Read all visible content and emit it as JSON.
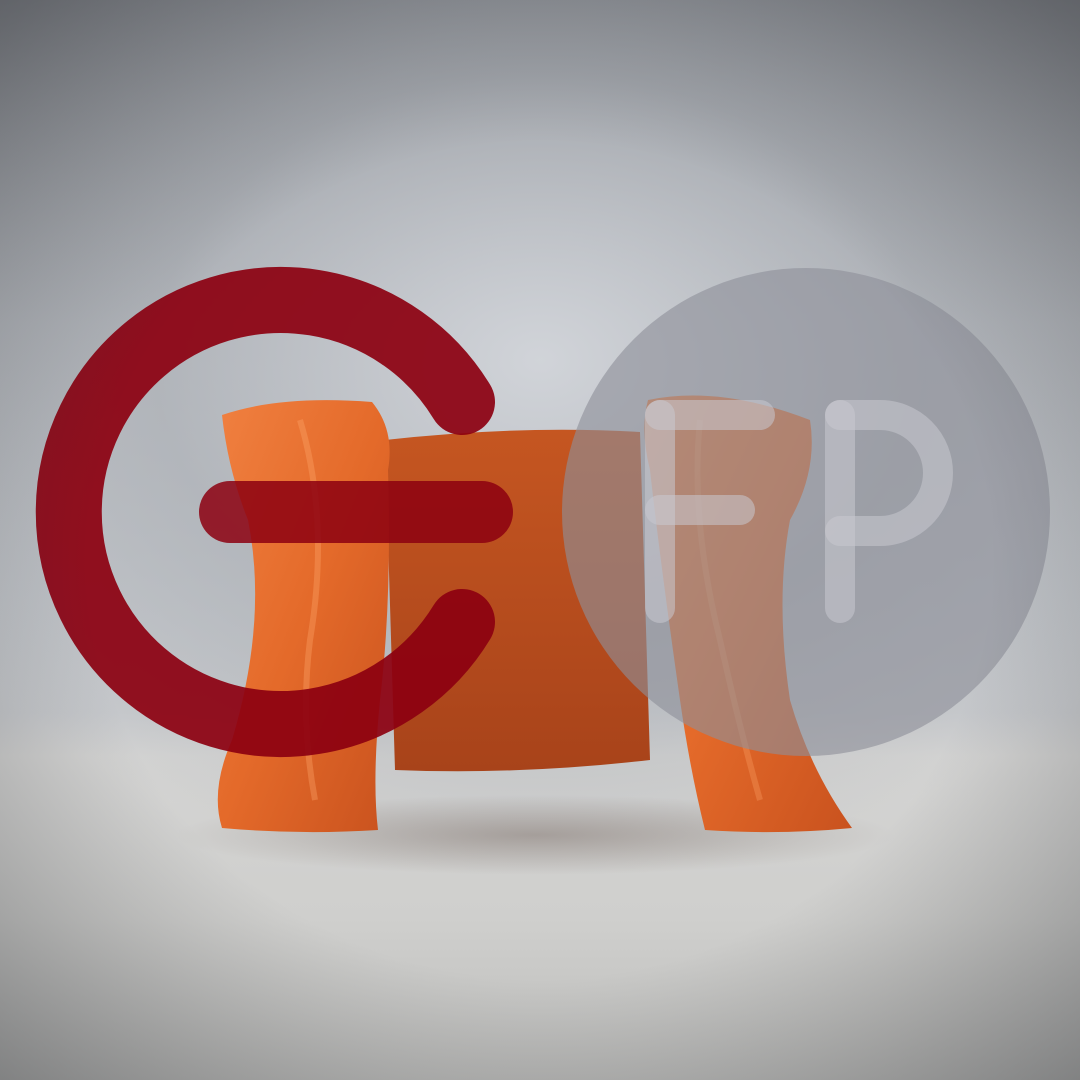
{
  "colors": {
    "clay": "#e46a2a",
    "clay_shadow": "#b8481a",
    "logo_red": "#8c0010",
    "logo_gray": "#8e9099",
    "logo_letters": "#c9c9cf"
  },
  "logo": {
    "letters": "FP"
  }
}
